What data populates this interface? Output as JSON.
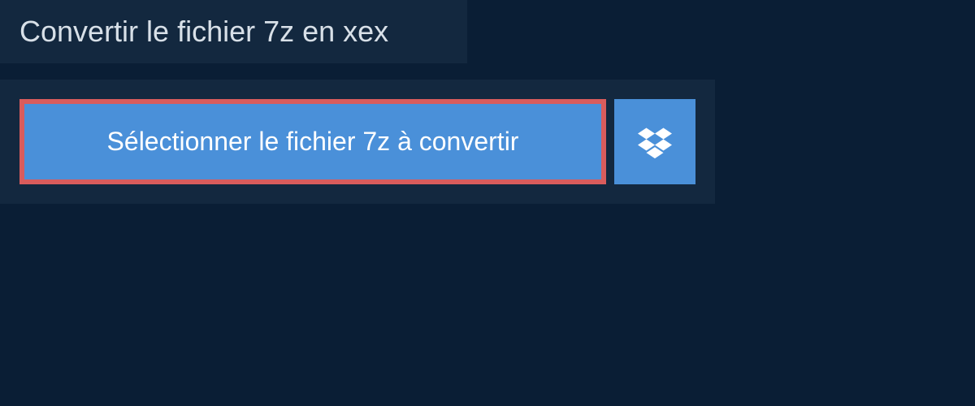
{
  "header": {
    "title": "Convertir le fichier 7z en xex"
  },
  "upload": {
    "select_button_label": "Sélectionner le fichier 7z à convertir"
  }
}
